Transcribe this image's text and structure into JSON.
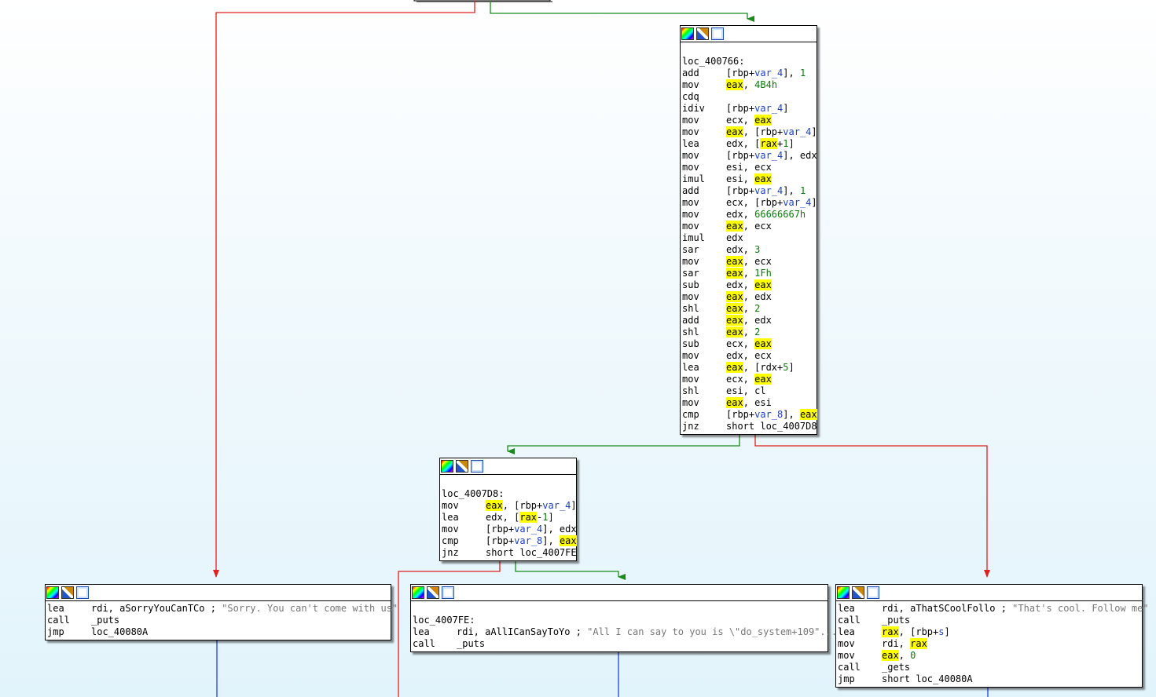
{
  "colors": {
    "edge_true": "#1a8a1a",
    "edge_false": "#e02020",
    "edge_jump": "#2040e0",
    "highlight": "#ffff00",
    "background_top": "#ffffff",
    "background_bottom": "#e2f4fb"
  },
  "node_header_icons": [
    "color-palette-icon",
    "edit-node-icon",
    "graph-view-icon"
  ],
  "blocks": {
    "loc_400766": {
      "label": "loc_400766:",
      "lines": [
        [
          "add",
          "[rbp+var_4], 1"
        ],
        [
          "mov",
          "eax, 4B4h"
        ],
        [
          "cdq",
          ""
        ],
        [
          "idiv",
          "[rbp+var_4]"
        ],
        [
          "mov",
          "ecx, eax"
        ],
        [
          "mov",
          "eax, [rbp+var_4]"
        ],
        [
          "lea",
          "edx, [rax+1]"
        ],
        [
          "mov",
          "[rbp+var_4], edx"
        ],
        [
          "mov",
          "esi, ecx"
        ],
        [
          "imul",
          "esi, eax"
        ],
        [
          "add",
          "[rbp+var_4], 1"
        ],
        [
          "mov",
          "ecx, [rbp+var_4]"
        ],
        [
          "mov",
          "edx, 66666667h"
        ],
        [
          "mov",
          "eax, ecx"
        ],
        [
          "imul",
          "edx"
        ],
        [
          "sar",
          "edx, 3"
        ],
        [
          "mov",
          "eax, ecx"
        ],
        [
          "sar",
          "eax, 1Fh"
        ],
        [
          "sub",
          "edx, eax"
        ],
        [
          "mov",
          "eax, edx"
        ],
        [
          "shl",
          "eax, 2"
        ],
        [
          "add",
          "eax, edx"
        ],
        [
          "shl",
          "eax, 2"
        ],
        [
          "sub",
          "ecx, eax"
        ],
        [
          "mov",
          "edx, ecx"
        ],
        [
          "lea",
          "eax, [rdx+5]"
        ],
        [
          "mov",
          "ecx, eax"
        ],
        [
          "shl",
          "esi, cl"
        ],
        [
          "mov",
          "eax, esi"
        ],
        [
          "cmp",
          "[rbp+var_8], eax"
        ],
        [
          "jnz",
          "short loc_4007D8"
        ]
      ]
    },
    "loc_4007D8": {
      "label": "loc_4007D8:",
      "lines": [
        [
          "mov",
          "eax, [rbp+var_4]"
        ],
        [
          "lea",
          "edx, [rax-1]"
        ],
        [
          "mov",
          "[rbp+var_4], edx"
        ],
        [
          "cmp",
          "[rbp+var_8], eax"
        ],
        [
          "jnz",
          "short loc_4007FE"
        ]
      ]
    },
    "sorry": {
      "lines": [
        [
          "lea",
          "rdi, aSorryYouCanTCo ; \"Sorry. You can't come with us\""
        ],
        [
          "call",
          "_puts"
        ],
        [
          "jmp",
          "loc_40080A"
        ]
      ]
    },
    "loc_4007FE": {
      "label": "loc_4007FE:",
      "lines": [
        [
          "lea",
          "rdi, aAllICanSayToYo ; \"All I can say to you is \\\"do_system+109\"..."
        ],
        [
          "call",
          "_puts"
        ]
      ]
    },
    "cool": {
      "lines": [
        [
          "lea",
          "rdi, aThatSCoolFollo ; \"That's cool. Follow me\""
        ],
        [
          "call",
          "_puts"
        ],
        [
          "lea",
          "rax, [rbp+s]"
        ],
        [
          "mov",
          "rdi, rax"
        ],
        [
          "mov",
          "eax, 0"
        ],
        [
          "call",
          "_gets"
        ],
        [
          "jmp",
          "short loc_40080A"
        ]
      ]
    }
  }
}
